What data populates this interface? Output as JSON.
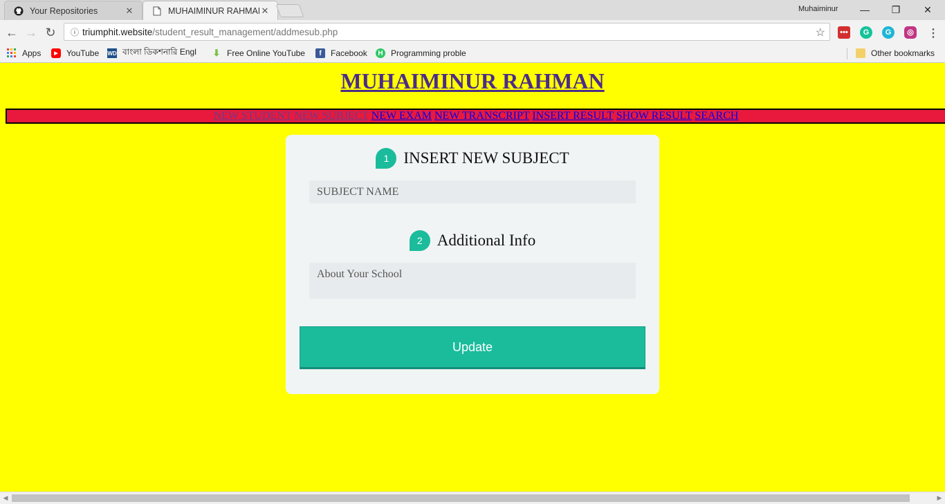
{
  "browser": {
    "tabs": [
      {
        "title": "Your Repositories",
        "icon": "github-icon"
      },
      {
        "title": "MUHAIMINUR RAHMAN",
        "icon": "page-icon"
      }
    ],
    "profile": "Muhaiminur",
    "url_host": "triumphit.website",
    "url_path": "/student_result_management/addmesub.php",
    "bookmarks": [
      {
        "label": "Apps",
        "icon": "apps-grid-icon"
      },
      {
        "label": "YouTube",
        "icon": "youtube-icon"
      },
      {
        "label": "বাংলা ডিকশনারি Engl",
        "icon": "wd-dictionary-icon"
      },
      {
        "label": "Free Online YouTube",
        "icon": "download-arrow-icon"
      },
      {
        "label": "Facebook",
        "icon": "facebook-icon"
      },
      {
        "label": "Programming proble",
        "icon": "hackerrank-icon"
      }
    ],
    "other_bookmarks": "Other bookmarks"
  },
  "page": {
    "site_title": "MUHAIMINUR RAHMAN",
    "nav": [
      {
        "label": "NEW STUDENT",
        "visited": true
      },
      {
        "label": "NEW SUBJECT",
        "visited": true
      },
      {
        "label": "NEW EXAM",
        "visited": false
      },
      {
        "label": "NEW TRANSCRIPT",
        "visited": false
      },
      {
        "label": "INSERT RESULT",
        "visited": false
      },
      {
        "label": "SHOW RESULT",
        "visited": false
      },
      {
        "label": "SEARCH",
        "visited": false
      }
    ],
    "form": {
      "step1_number": "1",
      "step1_title": "INSERT NEW SUBJECT",
      "subject_placeholder": "SUBJECT NAME",
      "step2_number": "2",
      "step2_title": "Additional Info",
      "about_placeholder": "About Your School",
      "submit_label": "Update"
    }
  },
  "colors": {
    "page_bg": "#ffff00",
    "nav_bg": "#e8193c",
    "accent": "#1abc9c",
    "title": "#4b2c89"
  }
}
